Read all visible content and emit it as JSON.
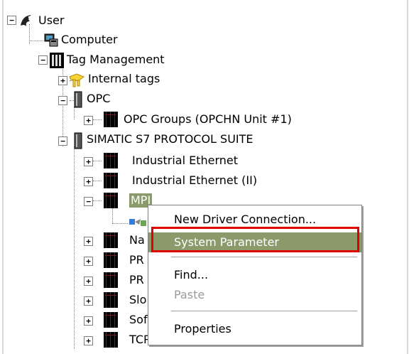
{
  "tree": {
    "root": {
      "label": "User",
      "expander": "−"
    },
    "computer": {
      "label": "Computer"
    },
    "tag_management": {
      "label": "Tag Management",
      "expander": "−"
    },
    "internal_tags": {
      "label": "Internal tags",
      "expander": "+"
    },
    "opc": {
      "label": "OPC",
      "expander": "−"
    },
    "opc_groups": {
      "label": "OPC Groups (OPCHN Unit #1)",
      "expander": "+"
    },
    "simatic": {
      "label": "SIMATIC S7 PROTOCOL SUITE",
      "expander": "−"
    },
    "industrial_ethernet": {
      "label": "Industrial Ethernet",
      "expander": "+"
    },
    "industrial_ethernet_ii": {
      "label": "Industrial Ethernet (II)",
      "expander": "+"
    },
    "mpi": {
      "label": "MPI",
      "expander": "−"
    },
    "partial": [
      {
        "label": "Na",
        "expander": "+"
      },
      {
        "label": "PR",
        "expander": "+"
      },
      {
        "label": "PR",
        "expander": "+"
      },
      {
        "label": "Slo",
        "expander": "+"
      },
      {
        "label": "Sof",
        "expander": "+"
      },
      {
        "label": "TCP/IP",
        "expander": "+"
      }
    ]
  },
  "context_menu": {
    "items": [
      {
        "label": "New Driver Connection..."
      },
      {
        "label": "System Parameter"
      },
      {
        "label": "Find..."
      },
      {
        "label": "Paste"
      },
      {
        "label": "Properties"
      }
    ]
  },
  "colors": {
    "selection": "#8a9a6b",
    "highlight_box": "#e00000"
  }
}
